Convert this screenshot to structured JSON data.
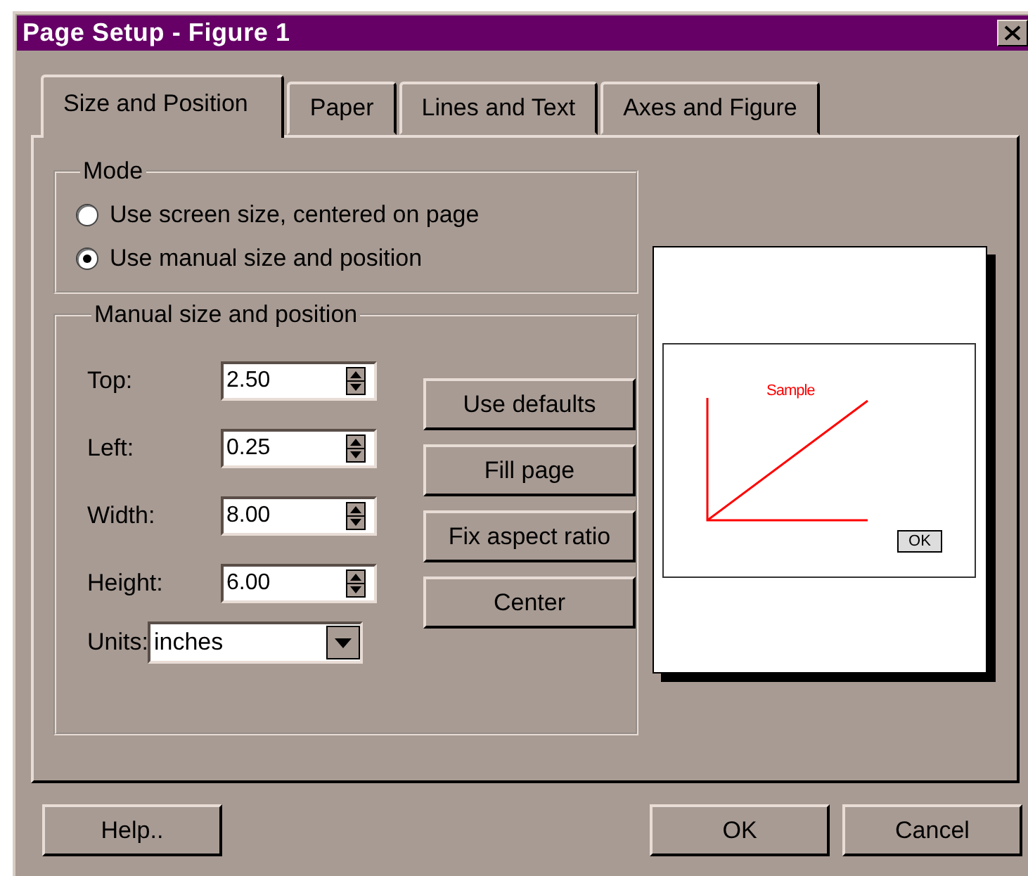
{
  "window": {
    "title": "Page Setup - Figure 1"
  },
  "tabs": [
    {
      "label": "Size and Position",
      "selected": true
    },
    {
      "label": "Paper",
      "selected": false
    },
    {
      "label": "Lines and Text",
      "selected": false
    },
    {
      "label": "Axes and Figure",
      "selected": false
    }
  ],
  "mode": {
    "legend": "Mode",
    "options": [
      {
        "label": "Use screen size, centered on page",
        "selected": false
      },
      {
        "label": "Use manual size and position",
        "selected": true
      }
    ]
  },
  "manual": {
    "legend": "Manual size and position",
    "fields": [
      {
        "label": "Top:",
        "value": "2.50"
      },
      {
        "label": "Left:",
        "value": "0.25"
      },
      {
        "label": "Width:",
        "value": "8.00"
      },
      {
        "label": "Height:",
        "value": "6.00"
      }
    ],
    "units": {
      "label": "Units:",
      "value": "inches"
    },
    "buttons": [
      "Use defaults",
      "Fill page",
      "Fix aspect ratio",
      "Center"
    ]
  },
  "preview": {
    "title": "Sample",
    "button": "OK"
  },
  "footer_buttons": [
    "Help..",
    "OK",
    "Cancel"
  ]
}
